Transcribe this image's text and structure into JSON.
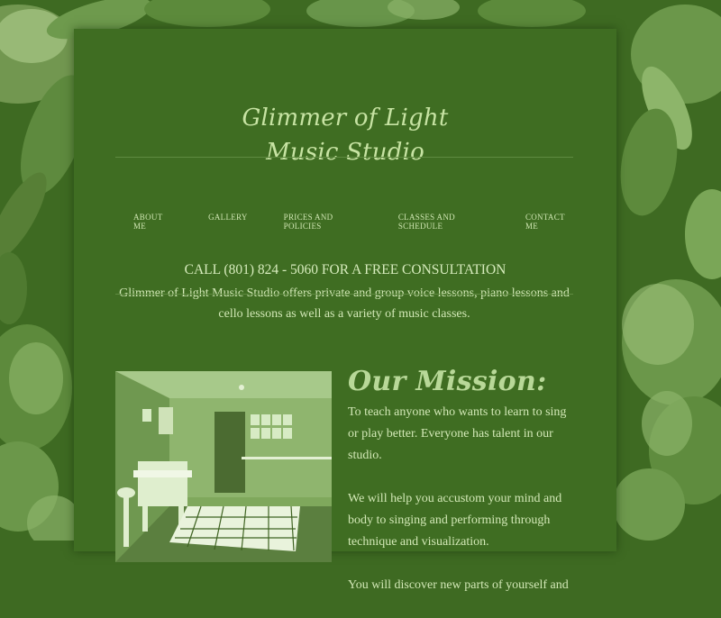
{
  "site": {
    "title_line1": "Glimmer of Light",
    "title_line2": "Music Studio"
  },
  "nav": {
    "items": [
      {
        "label": "ABOUT ME"
      },
      {
        "label": "GALLERY"
      },
      {
        "label": "PRICES AND POLICIES"
      },
      {
        "label": "CLASSES AND SCHEDULE"
      },
      {
        "label": "CONTACT ME"
      }
    ]
  },
  "hero": {
    "cta": "CALL (801) 824 - 5060 FOR A FREE CONSULTATION",
    "intro": "Glimmer of Light Music Studio offers private and group voice lessons, piano lessons and cello lessons as well as a variety of music classes."
  },
  "mission": {
    "heading": "Our Mission:",
    "paragraphs": [
      "To teach anyone who wants to learn to sing or play better. Everyone has talent in our studio.",
      "We will help you accustom your mind and body to singing and performing through technique and visualization.",
      "You will discover new parts of yourself and"
    ]
  },
  "colors": {
    "background": "#3e6a22",
    "panel": "#3f6d22",
    "text_light": "#d2e8b6",
    "accent": "#b8d898"
  }
}
